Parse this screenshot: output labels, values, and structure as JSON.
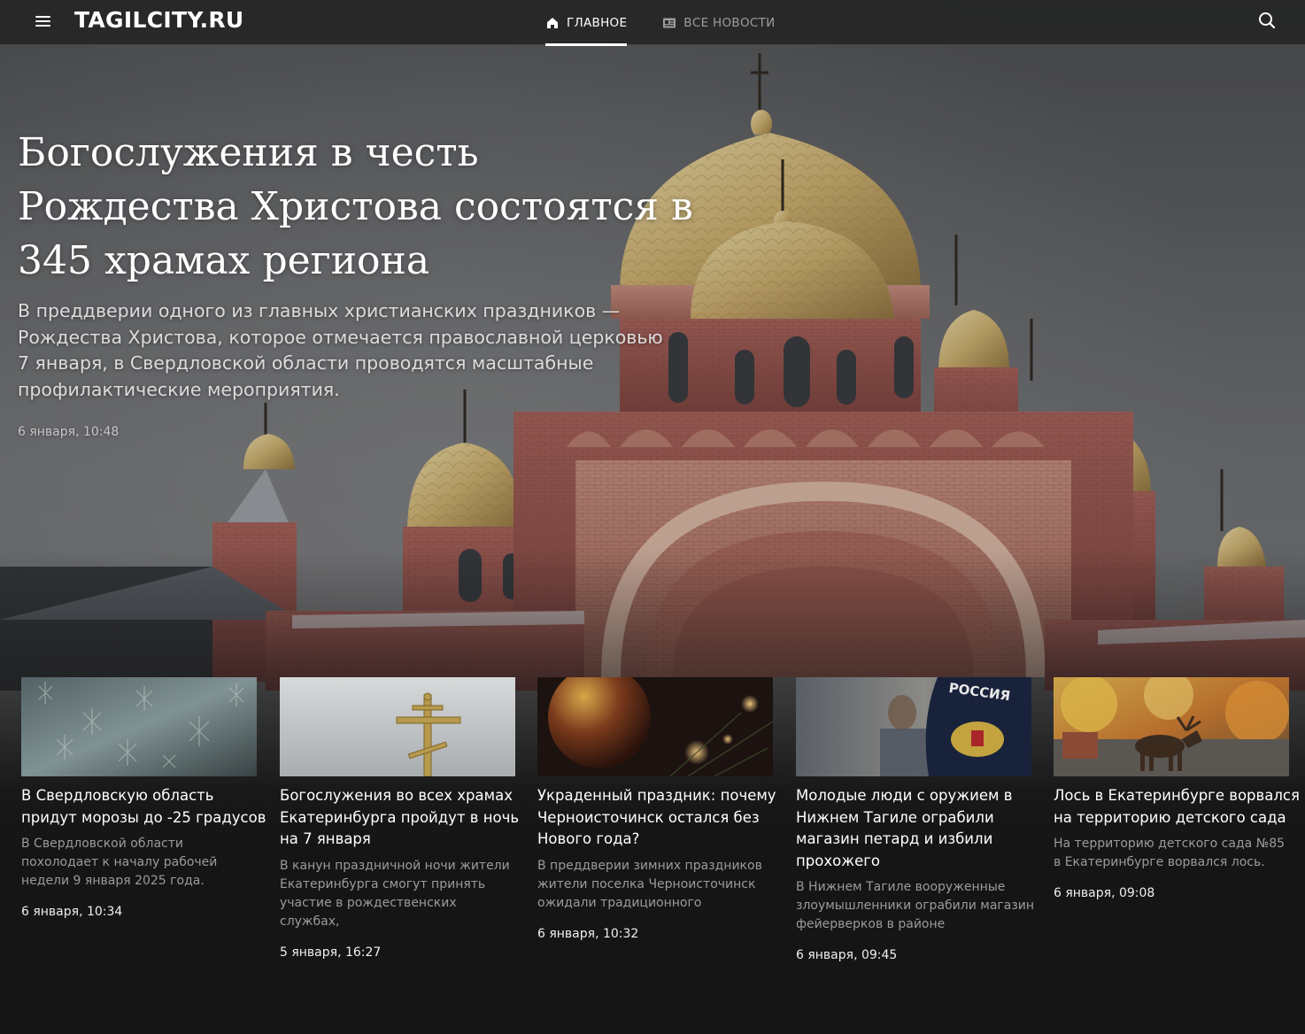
{
  "site": {
    "logo": "TAGILCITY.RU"
  },
  "nav": [
    {
      "label": "ГЛАВНОЕ",
      "icon": "home-icon",
      "active": true
    },
    {
      "label": "ВСЕ НОВОСТИ",
      "icon": "newspaper-icon",
      "active": false
    }
  ],
  "hero": {
    "title": "Богослужения в честь Рождества Христова состоятся в 345 храмах региона",
    "lead": "В преддверии одного из главных христианских праздников — Рождества Христова, которое отмечается православной церковью 7 января, в Свердловской области проводятся масштабные профилактические мероприятия.",
    "date": "6 января, 10:48"
  },
  "cards": [
    {
      "title": "В Свердловскую область придут морозы до -25 градусов",
      "lead": "В Свердловской области похолодает к началу рабочей недели 9 января 2025 года.",
      "date": "6 января, 10:34",
      "image": "frosted-window"
    },
    {
      "title": "Богослужения во всех храмах Екатеринбурга пройдут в ночь на 7 января",
      "lead": "В канун праздничной ночи жители Екатеринбурга смогут принять участие в рождественских службах,",
      "date": "5 января, 16:27",
      "image": "golden-cross"
    },
    {
      "title": "Украденный праздник: почему Черноисточинск остался без Нового года?",
      "lead": "В преддверии зимних праздников жители поселка Черноисточинск ожидали традиционного",
      "date": "6 января, 10:32",
      "image": "christmas-ornament"
    },
    {
      "title": "Молодые люди с оружием в Нижнем Тагиле ограбили магазин петард и избили прохожего",
      "lead": "В Нижнем Тагиле вооруженные злоумышленники ограбили магазин фейерверков в районе",
      "date": "6 января, 09:45",
      "image": "police-patch",
      "image_text": "РОССИЯ"
    },
    {
      "title": "Лось в Екатеринбурге ворвался на территорию детского сада",
      "lead": "На территорию детского сада №85 в Екатеринбурге ворвался лось.",
      "date": "6 января, 09:08",
      "image": "moose-autumn"
    }
  ],
  "colors": {
    "background": "#151515",
    "topbar": "#262626",
    "muted_text": "#9b9b9b"
  }
}
